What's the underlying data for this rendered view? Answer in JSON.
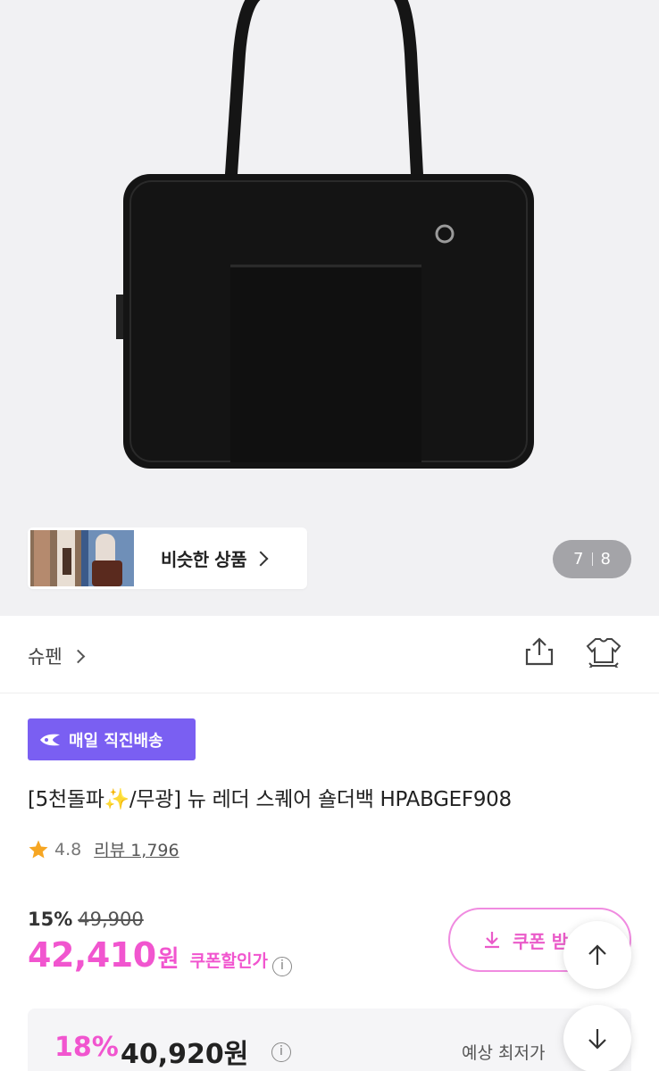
{
  "similar": {
    "label": "비슷한 상품"
  },
  "pager": {
    "current": "7",
    "total": "8"
  },
  "brand": {
    "name": "슈펜"
  },
  "badge": {
    "label": "매일 직진배송"
  },
  "product": {
    "title": "[5천돌파✨/무광] 뉴 레더 스퀘어 숄더백 HPABGEF908",
    "rating": "4.8",
    "review_label": "리뷰 1,796",
    "discount_pct": "15%",
    "original_price": "49,900",
    "sale_price": "42,410",
    "won": "원",
    "coupon_price_label": "쿠폰할인가"
  },
  "coupon_button": {
    "label": "쿠폰 받"
  },
  "best_price": {
    "pct": "18%",
    "amount": "40,920원",
    "note": "예상 최저가"
  },
  "icons": {
    "share": "share-icon",
    "size": "size-chart-icon",
    "star": "star-icon",
    "info": "info-icon",
    "download": "download-icon",
    "arrow_up": "arrow-up-icon",
    "arrow_down": "arrow-down-icon",
    "delivery": "delivery-logo-icon",
    "chevron": "chevron-right-icon"
  },
  "colors": {
    "accent_pink": "#f155cf",
    "badge_purple": "#7a5ff2",
    "hero_bg": "#f1f1f3"
  }
}
